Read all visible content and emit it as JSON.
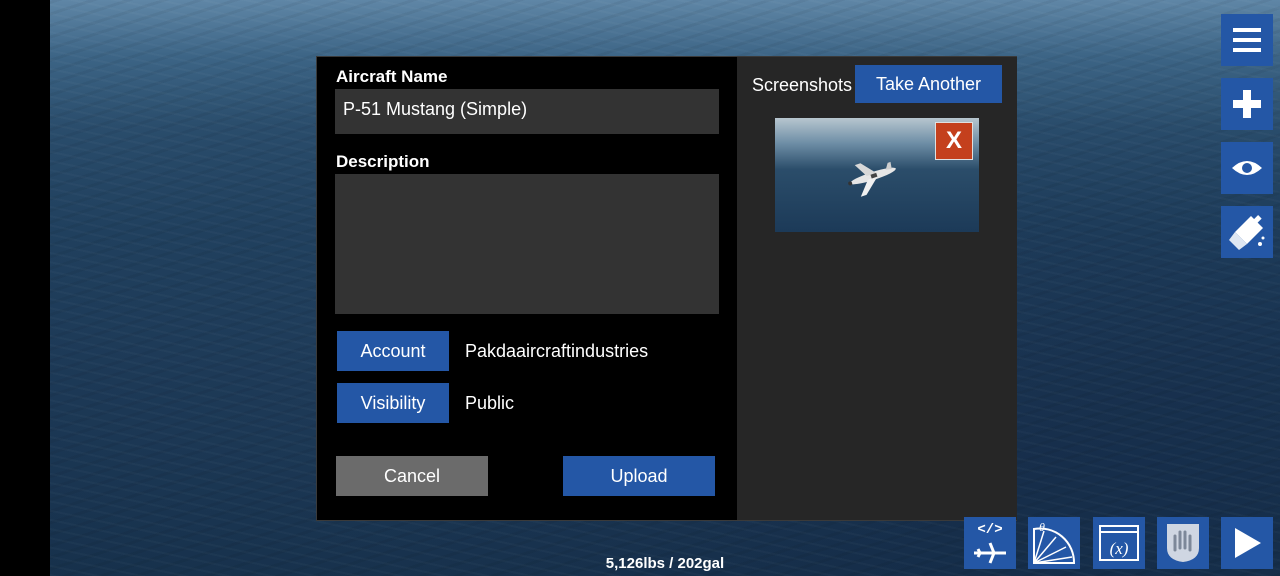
{
  "dialog": {
    "aircraft_name_label": "Aircraft Name",
    "aircraft_name_value": "P-51 Mustang (Simple)",
    "description_label": "Description",
    "description_value": "",
    "account_button": "Account",
    "account_value": "Pakdaaircraftindustries",
    "visibility_button": "Visibility",
    "visibility_value": "Public",
    "cancel_button": "Cancel",
    "upload_button": "Upload",
    "screenshots_label": "Screenshots",
    "take_another_button": "Take Another",
    "thumbnail_close": "X"
  },
  "status": {
    "weight_fuel": "5,126lbs / 202gal"
  },
  "icons": {
    "side": [
      "menu-icon",
      "plus-icon",
      "eye-icon",
      "paint-brush-icon"
    ],
    "bottom": [
      "airplane-code-icon",
      "protractor-icon",
      "variables-icon",
      "hand-icon",
      "play-icon"
    ]
  },
  "colors": {
    "accent_blue": "#2457a6",
    "cancel_gray": "#6b6b6b",
    "close_red": "#c4401d",
    "panel_dark": "#262626",
    "input_bg": "#333333"
  }
}
